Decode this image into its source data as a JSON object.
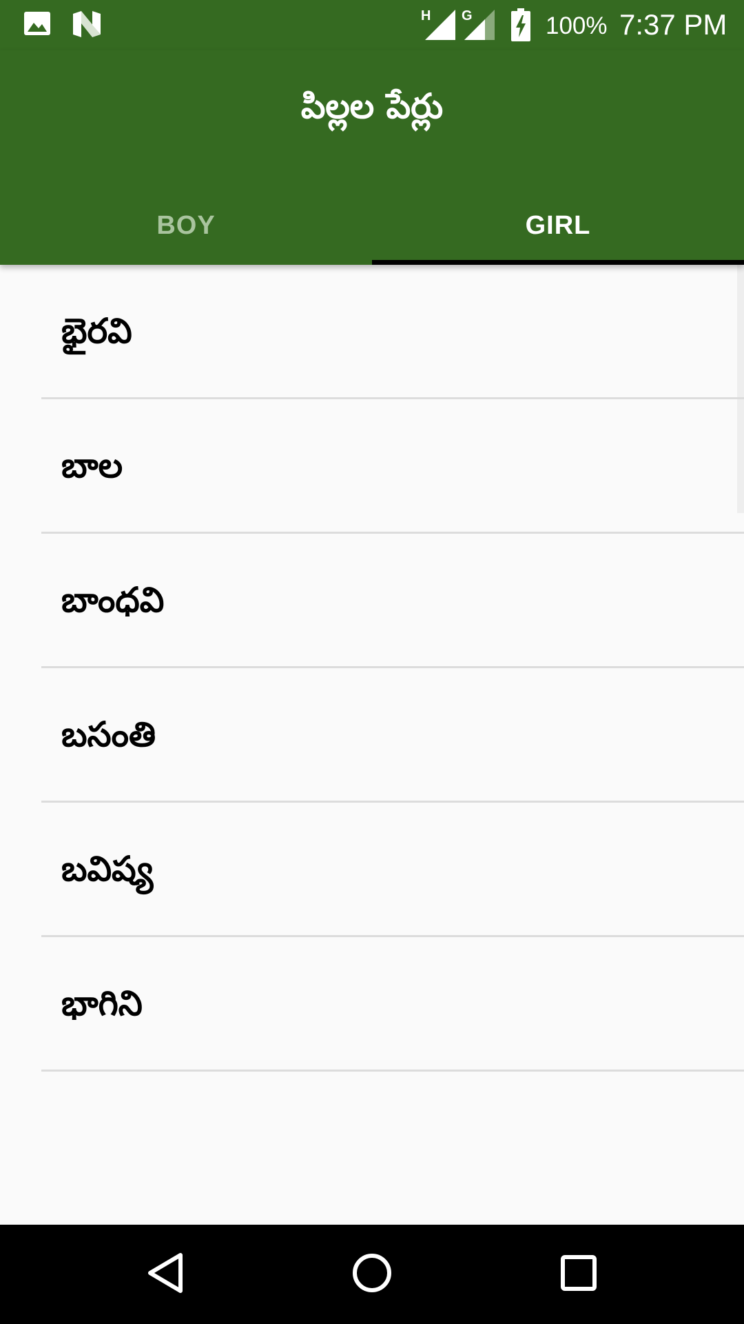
{
  "status_bar": {
    "icons": [
      "image-icon",
      "n-icon",
      "signal-h-icon",
      "signal-g-icon",
      "battery-charging-icon"
    ],
    "net_label_1": "H",
    "net_label_2": "G",
    "battery": "100%",
    "time": "7:37 PM"
  },
  "app_bar": {
    "title": "పిల్లల పేర్లు",
    "color": "#356a21"
  },
  "tabs": [
    {
      "label": "BOY",
      "selected": false
    },
    {
      "label": "GIRL",
      "selected": true
    }
  ],
  "list": {
    "items": [
      {
        "label": "భైరవి"
      },
      {
        "label": "బాల"
      },
      {
        "label": "బాంధవి"
      },
      {
        "label": "బసంతి"
      },
      {
        "label": "బవిష్య"
      },
      {
        "label": "భాగిని"
      }
    ]
  },
  "nav_bar": {
    "icons": [
      "back-icon",
      "home-icon",
      "recents-icon"
    ]
  }
}
